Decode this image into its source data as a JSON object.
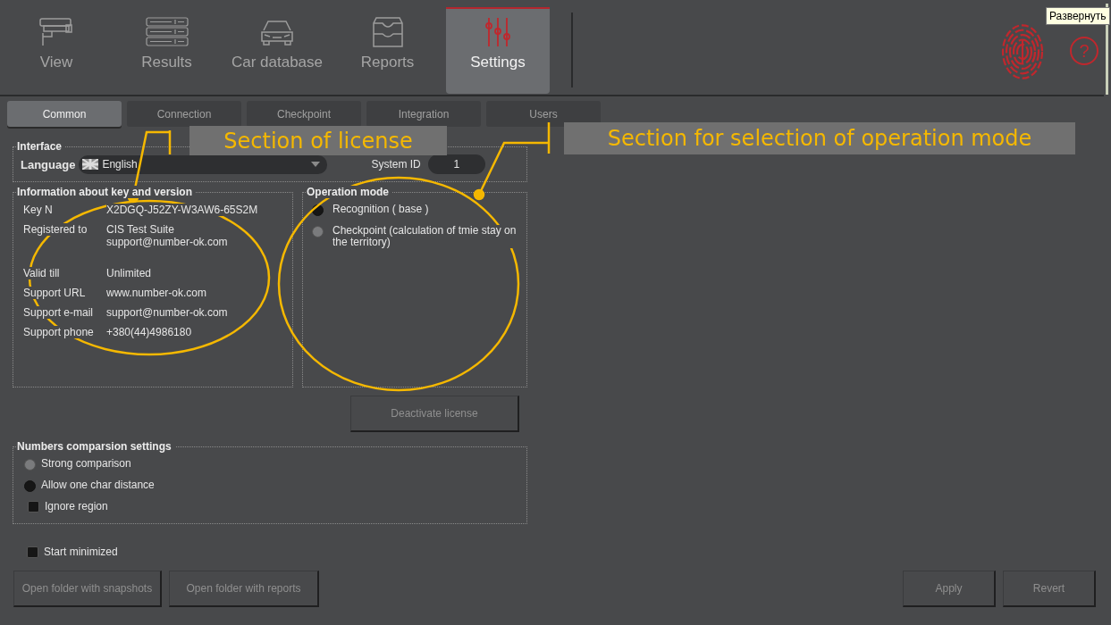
{
  "nav": {
    "items": [
      {
        "label": "View",
        "selected": false
      },
      {
        "label": "Results",
        "selected": false
      },
      {
        "label": "Car database",
        "selected": false
      },
      {
        "label": "Reports",
        "selected": false
      },
      {
        "label": "Settings",
        "selected": true
      }
    ]
  },
  "help": "?",
  "tooltip": "Развернуть",
  "tabs": [
    {
      "label": "Common",
      "selected": true
    },
    {
      "label": "Connection",
      "selected": false
    },
    {
      "label": "Checkpoint",
      "selected": false
    },
    {
      "label": "Integration",
      "selected": false
    },
    {
      "label": "Users",
      "selected": false
    }
  ],
  "interface": {
    "title": "Interface",
    "language_label": "Language",
    "language": "English",
    "system_id_label": "System ID",
    "system_id": "1"
  },
  "license": {
    "title": "Information about key and version",
    "rows": [
      {
        "label": "Key N",
        "values": [
          "X2DGQ-J52ZY-W3AW6-65S2M"
        ]
      },
      {
        "label": "Registered to",
        "values": [
          "CIS Test Suite",
          "support@number-ok.com"
        ]
      },
      {
        "label": "Valid till",
        "values": [
          "Unlimited"
        ]
      },
      {
        "label": "Support URL",
        "values": [
          "www.number-ok.com"
        ]
      },
      {
        "label": "Support e-mail",
        "values": [
          "support@number-ok.com"
        ]
      },
      {
        "label": "Support phone",
        "values": [
          "+380(44)4986180"
        ]
      }
    ]
  },
  "operation_mode": {
    "title": "Operation mode",
    "options": [
      {
        "label": "Recognition ( base )",
        "selected": true
      },
      {
        "label": "Checkpoint (calculation of tmie stay on the territory)",
        "selected": false
      }
    ]
  },
  "deactivate_button": "Deactivate license",
  "comparison": {
    "title": "Numbers comparsion settings",
    "options": [
      {
        "kind": "radio",
        "label": "Strong comparison",
        "selected": false
      },
      {
        "kind": "radio",
        "label": "Allow one char distance",
        "selected": true
      },
      {
        "kind": "checkbox",
        "label": "Ignore region",
        "checked": false
      }
    ]
  },
  "start_minimized": {
    "label": "Start minimized",
    "checked": false
  },
  "buttons_left": [
    "Open folder with snapshots",
    "Open folder with reports"
  ],
  "buttons_right": [
    "Apply",
    "Revert"
  ],
  "annotations": [
    {
      "text": "Section of license"
    },
    {
      "text": "Section for selection of operation mode"
    }
  ]
}
